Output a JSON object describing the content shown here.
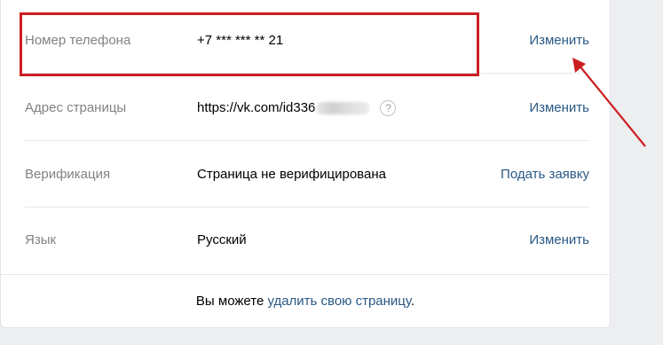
{
  "settings": {
    "rows": [
      {
        "label": "Номер телефона",
        "value": "+7 *** *** ** 21",
        "action": "Изменить"
      },
      {
        "label": "Адрес страницы",
        "value": "https://vk.com/id336",
        "action": "Изменить"
      },
      {
        "label": "Верификация",
        "value": "Страница не верифицирована",
        "action": "Подать заявку"
      },
      {
        "label": "Язык",
        "value": "Русский",
        "action": "Изменить"
      }
    ],
    "help_icon": "?"
  },
  "footer": {
    "text_before": "Вы можете ",
    "link": "удалить свою страницу",
    "text_after": "."
  },
  "colors": {
    "link": "#2a5885",
    "annotation": "#cc1f24"
  }
}
